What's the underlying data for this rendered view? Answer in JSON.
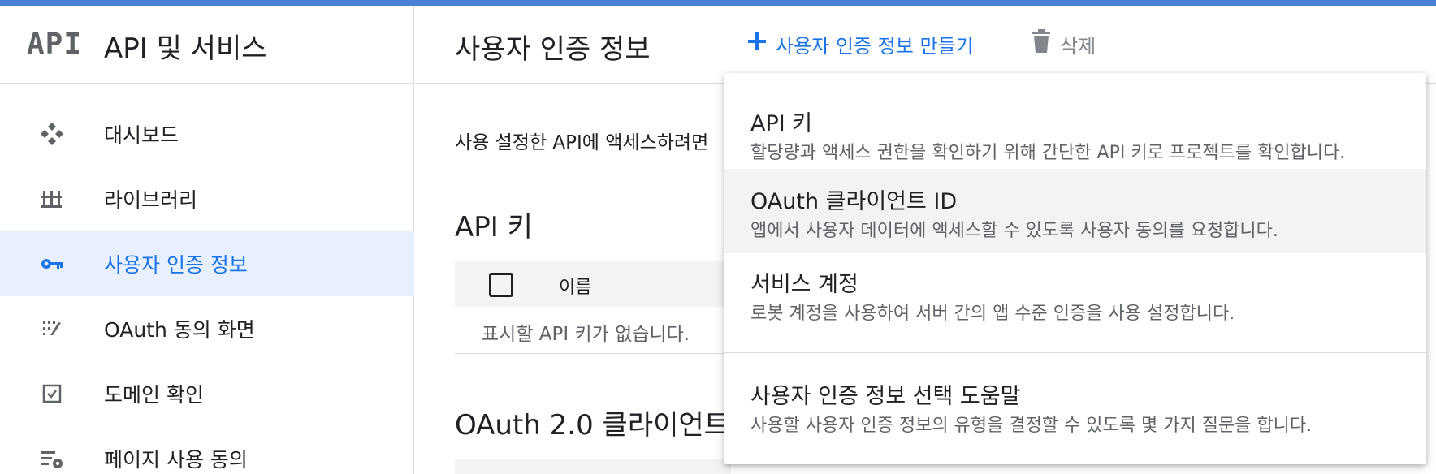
{
  "app": {
    "logo_text": "API",
    "section_title": "API 및 서비스"
  },
  "sidebar": {
    "items": [
      {
        "label": "대시보드",
        "icon": "dashboard-icon",
        "active": false
      },
      {
        "label": "라이브러리",
        "icon": "library-icon",
        "active": false
      },
      {
        "label": "사용자 인증 정보",
        "icon": "key-icon",
        "active": true
      },
      {
        "label": "OAuth 동의 화면",
        "icon": "consent-icon",
        "active": false
      },
      {
        "label": "도메인 확인",
        "icon": "checkbox-icon",
        "active": false
      },
      {
        "label": "페이지 사용 동의",
        "icon": "settings-list-icon",
        "active": false
      }
    ]
  },
  "header": {
    "title": "사용자 인증 정보",
    "create_label": "사용자 인증 정보 만들기",
    "delete_label": "삭제"
  },
  "main": {
    "description": "사용 설정한 API에 액세스하려면",
    "api_keys_title": "API 키",
    "column_name": "이름",
    "empty_message": "표시할 API 키가 없습니다.",
    "oauth_title": "OAuth 2.0 클라이언트"
  },
  "menu": {
    "items": [
      {
        "title": "API 키",
        "subtitle": "할당량과 액세스 권한을 확인하기 위해 간단한 API 키로 프로젝트를 확인합니다."
      },
      {
        "title": "OAuth 클라이언트 ID",
        "subtitle": "앱에서 사용자 데이터에 액세스할 수 있도록 사용자 동의를 요청합니다."
      },
      {
        "title": "서비스 계정",
        "subtitle": "로봇 계정을 사용하여 서버 간의 앱 수준 인증을 사용 설정합니다."
      },
      {
        "title": "사용자 인증 정보 선택 도움말",
        "subtitle": "사용할 사용자 인증 정보의 유형을 결정할 수 있도록 몇 가지 질문을 합니다."
      }
    ]
  },
  "colors": {
    "accent": "#1a73e8",
    "top_bar": "#4b7fd8",
    "active_bg": "#e8f0fe"
  }
}
